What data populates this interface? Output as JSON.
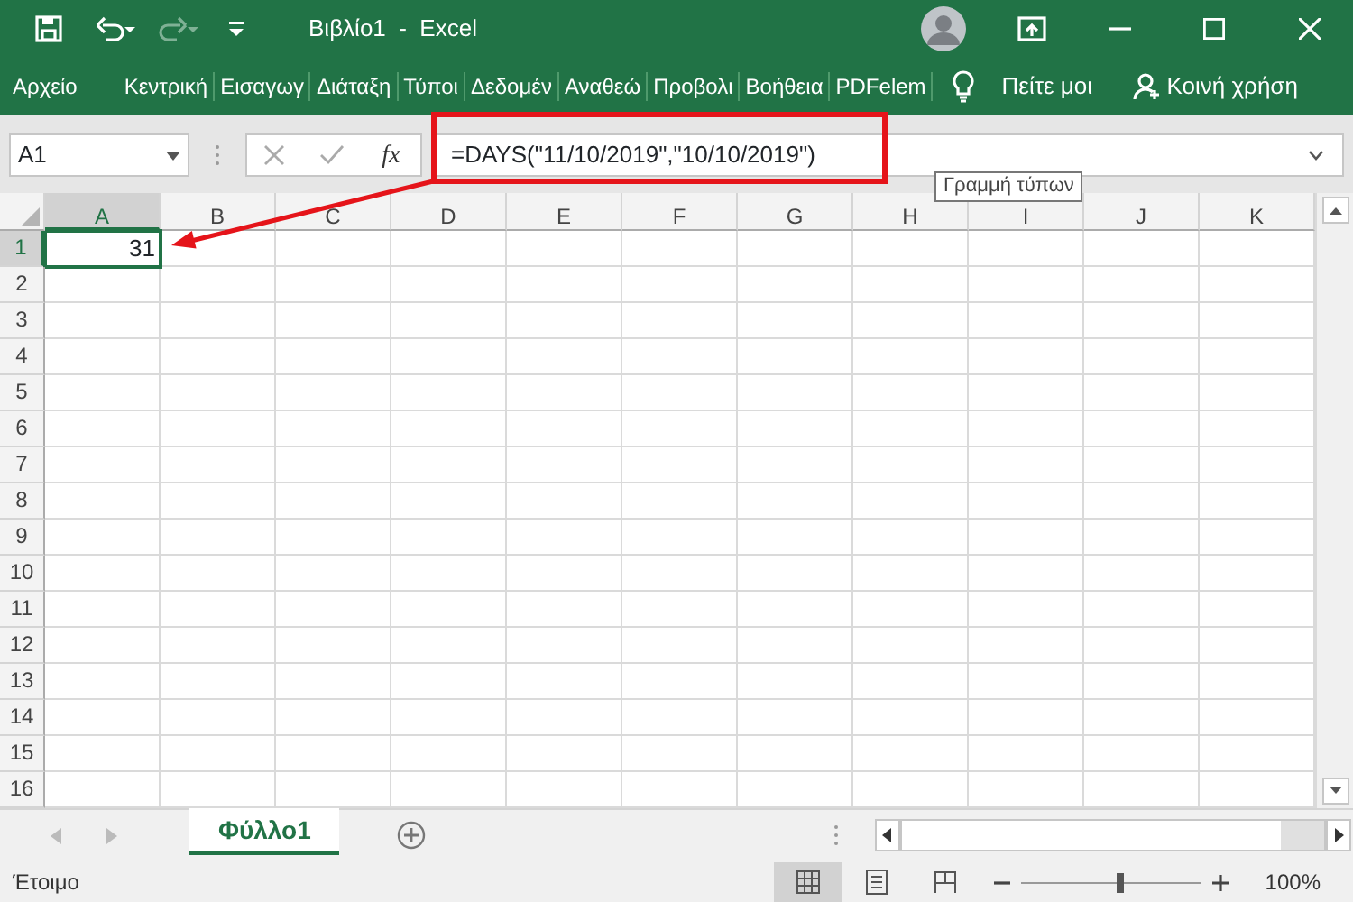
{
  "title_bar": {
    "title": "Βιβλίο1  -  Excel"
  },
  "ribbon_tabs": [
    "Αρχείο",
    "Κεντρική",
    "Εισαγωγ",
    "Διάταξη",
    "Τύποι",
    "Δεδομέν",
    "Αναθεώ",
    "Προβολι",
    "Βοήθεια",
    "PDFelem"
  ],
  "tell_me": "Πείτε μοι",
  "share": "Κοινή χρήση",
  "name_box": "A1",
  "fx": "fx",
  "formula": "=DAYS(\"11/10/2019\",\"10/10/2019\")",
  "tooltip": "Γραμμή τύπων",
  "columns": [
    {
      "label": "A",
      "selected": true
    },
    {
      "label": "B",
      "selected": false
    },
    {
      "label": "C",
      "selected": false
    },
    {
      "label": "D",
      "selected": false
    },
    {
      "label": "E",
      "selected": false
    },
    {
      "label": "F",
      "selected": false
    },
    {
      "label": "G",
      "selected": false
    },
    {
      "label": "H",
      "selected": false
    },
    {
      "label": "I",
      "selected": false
    },
    {
      "label": "J",
      "selected": false
    },
    {
      "label": "K",
      "selected": false
    }
  ],
  "rows": [
    {
      "label": "1",
      "selected": true,
      "cells": [
        "31"
      ]
    },
    {
      "label": "2",
      "selected": false,
      "cells": []
    },
    {
      "label": "3",
      "selected": false,
      "cells": []
    },
    {
      "label": "4",
      "selected": false,
      "cells": []
    },
    {
      "label": "5",
      "selected": false,
      "cells": []
    },
    {
      "label": "6",
      "selected": false,
      "cells": []
    },
    {
      "label": "7",
      "selected": false,
      "cells": []
    },
    {
      "label": "8",
      "selected": false,
      "cells": []
    },
    {
      "label": "9",
      "selected": false,
      "cells": []
    },
    {
      "label": "10",
      "selected": false,
      "cells": []
    },
    {
      "label": "11",
      "selected": false,
      "cells": []
    },
    {
      "label": "12",
      "selected": false,
      "cells": []
    },
    {
      "label": "13",
      "selected": false,
      "cells": []
    },
    {
      "label": "14",
      "selected": false,
      "cells": []
    },
    {
      "label": "15",
      "selected": false,
      "cells": []
    },
    {
      "label": "16",
      "selected": false,
      "cells": []
    }
  ],
  "sheet_tabs": [
    {
      "label": "Φύλλο1",
      "selected": true
    }
  ],
  "status": "Έτοιμο",
  "views": [
    {
      "kind": "normal",
      "selected": true
    },
    {
      "kind": "layout",
      "selected": false
    },
    {
      "kind": "breaks",
      "selected": false
    }
  ],
  "zoom": {
    "level": 0.55,
    "reading": "100%"
  }
}
